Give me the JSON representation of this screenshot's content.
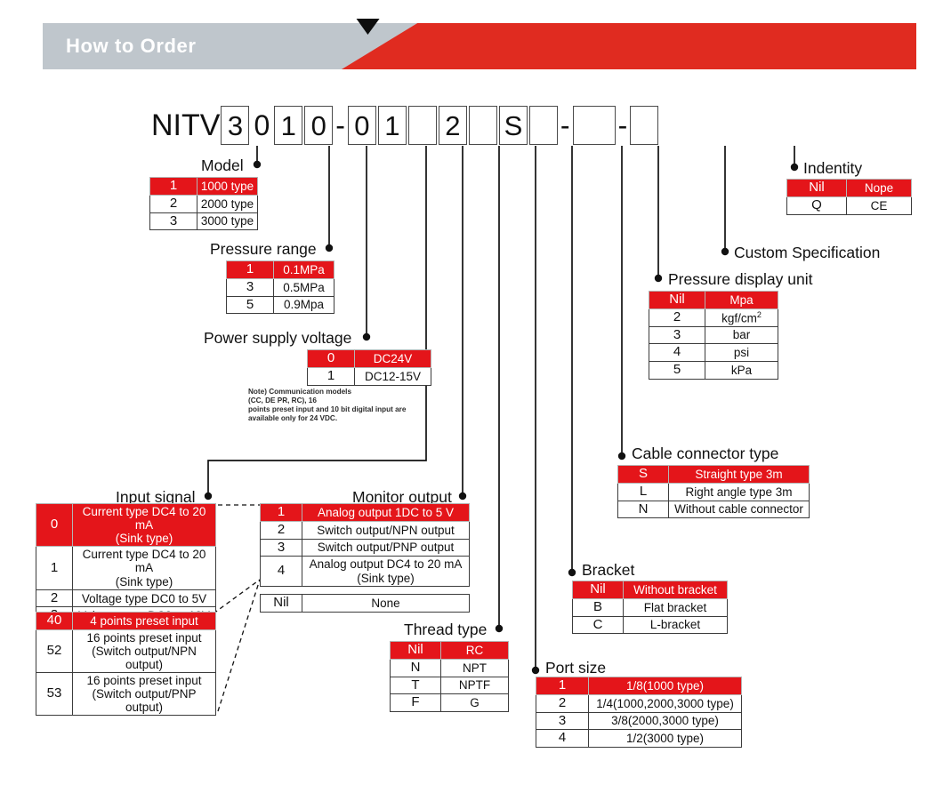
{
  "header": {
    "title": "How to Order",
    "gray": "#bfc6cc",
    "red": "#e02b20"
  },
  "accent": {
    "highlight": "#e4151a",
    "text": "#111111"
  },
  "part_number": {
    "prefix": "NITV",
    "segments": [
      {
        "type": "box",
        "value": "3",
        "width": "normal"
      },
      {
        "type": "plain",
        "value": "0"
      },
      {
        "type": "box",
        "value": "1",
        "width": "normal"
      },
      {
        "type": "box",
        "value": "0",
        "width": "normal"
      },
      {
        "type": "dash",
        "value": "-"
      },
      {
        "type": "box",
        "value": "0",
        "width": "normal"
      },
      {
        "type": "box",
        "value": "1",
        "width": "normal"
      },
      {
        "type": "box",
        "value": "",
        "width": "normal"
      },
      {
        "type": "box",
        "value": "2",
        "width": "normal"
      },
      {
        "type": "box",
        "value": "",
        "width": "normal"
      },
      {
        "type": "box",
        "value": "S",
        "width": "normal"
      },
      {
        "type": "box",
        "value": "",
        "width": "normal"
      },
      {
        "type": "dash",
        "value": "-"
      },
      {
        "type": "box",
        "value": "",
        "width": "wide"
      },
      {
        "type": "dash",
        "value": "-"
      },
      {
        "type": "box",
        "value": "",
        "width": "normal"
      }
    ]
  },
  "options": {
    "model": {
      "label": "Model",
      "rows": [
        {
          "code": "1",
          "desc": "1000 type",
          "highlight": true
        },
        {
          "code": "2",
          "desc": "2000 type",
          "highlight": false
        },
        {
          "code": "3",
          "desc": "3000 type",
          "highlight": false
        }
      ]
    },
    "pressure_range": {
      "label": "Pressure range",
      "rows": [
        {
          "code": "1",
          "desc": "0.1MPa",
          "highlight": true
        },
        {
          "code": "3",
          "desc": "0.5MPa",
          "highlight": false
        },
        {
          "code": "5",
          "desc": "0.9Mpa",
          "highlight": false
        }
      ]
    },
    "power_supply_voltage": {
      "label": "Power supply voltage",
      "rows": [
        {
          "code": "0",
          "desc": "DC24V",
          "highlight": true
        },
        {
          "code": "1",
          "desc": "DC12-15V",
          "highlight": false
        }
      ],
      "note": "Note) Communication models\n(CC, DE PR, RC), 16\npoints preset input and 10 bit digital input are\navailable only for 24 VDC."
    },
    "input_signal": {
      "label": "Input signal",
      "rows": [
        {
          "code": "0",
          "desc": "Current type DC4 to 20 mA\n(Sink type)",
          "highlight": true
        },
        {
          "code": "1",
          "desc": "Current type DC4 to 20 mA\n(Sink type)",
          "highlight": false
        },
        {
          "code": "2",
          "desc": "Voltage type DC0 to 5V",
          "highlight": false
        },
        {
          "code": "3",
          "desc": "Voltage type DC0 to 10V",
          "highlight": false
        }
      ],
      "rows2": [
        {
          "code": "40",
          "desc": "4 points preset input",
          "highlight": true
        },
        {
          "code": "52",
          "desc": "16 points preset input\n(Switch output/NPN output)",
          "highlight": false
        },
        {
          "code": "53",
          "desc": "16 points preset input\n(Switch output/PNP output)",
          "highlight": false
        }
      ]
    },
    "monitor_output": {
      "label": "Monitor output",
      "rows": [
        {
          "code": "1",
          "desc": "Analog output 1DC to 5 V",
          "highlight": true
        },
        {
          "code": "2",
          "desc": "Switch output/NPN output",
          "highlight": false
        },
        {
          "code": "3",
          "desc": "Switch output/PNP output",
          "highlight": false
        },
        {
          "code": "4",
          "desc": "Analog output DC4 to 20 mA\n(Sink type)",
          "highlight": false
        }
      ],
      "rows2": [
        {
          "code": "Nil",
          "desc": "None",
          "highlight": false
        }
      ]
    },
    "thread_type": {
      "label": "Thread type",
      "rows": [
        {
          "code": "Nil",
          "desc": "RC",
          "highlight": true
        },
        {
          "code": "N",
          "desc": "NPT",
          "highlight": false
        },
        {
          "code": "T",
          "desc": "NPTF",
          "highlight": false
        },
        {
          "code": "F",
          "desc": "G",
          "highlight": false
        }
      ]
    },
    "port_size": {
      "label": "Port size",
      "rows": [
        {
          "code": "1",
          "desc": "1/8(1000 type)",
          "highlight": true
        },
        {
          "code": "2",
          "desc": "1/4(1000,2000,3000 type)",
          "highlight": false
        },
        {
          "code": "3",
          "desc": "3/8(2000,3000 type)",
          "highlight": false
        },
        {
          "code": "4",
          "desc": "1/2(3000 type)",
          "highlight": false
        }
      ]
    },
    "bracket": {
      "label": "Bracket",
      "rows": [
        {
          "code": "Nil",
          "desc": "Without bracket",
          "highlight": true
        },
        {
          "code": "B",
          "desc": "Flat bracket",
          "highlight": false
        },
        {
          "code": "C",
          "desc": "L-bracket",
          "highlight": false
        }
      ]
    },
    "cable_connector_type": {
      "label": "Cable connector type",
      "rows": [
        {
          "code": "S",
          "desc": "Straight type 3m",
          "highlight": true
        },
        {
          "code": "L",
          "desc": "Right angle type 3m",
          "highlight": false
        },
        {
          "code": "N",
          "desc": "Without cable connector",
          "highlight": false
        }
      ]
    },
    "pressure_display_unit": {
      "label": "Pressure display unit",
      "rows": [
        {
          "code": "Nil",
          "desc": "Mpa",
          "highlight": true
        },
        {
          "code": "2",
          "desc": "kgf/cm2",
          "highlight": false
        },
        {
          "code": "3",
          "desc": "bar",
          "highlight": false
        },
        {
          "code": "4",
          "desc": "psi",
          "highlight": false
        },
        {
          "code": "5",
          "desc": "kPa",
          "highlight": false
        }
      ]
    },
    "custom_specification": {
      "label": "Custom Specification"
    },
    "indentity": {
      "label": "Indentity",
      "rows": [
        {
          "code": "Nil",
          "desc": "Nope",
          "highlight": true
        },
        {
          "code": "Q",
          "desc": "CE",
          "highlight": false
        }
      ]
    }
  }
}
